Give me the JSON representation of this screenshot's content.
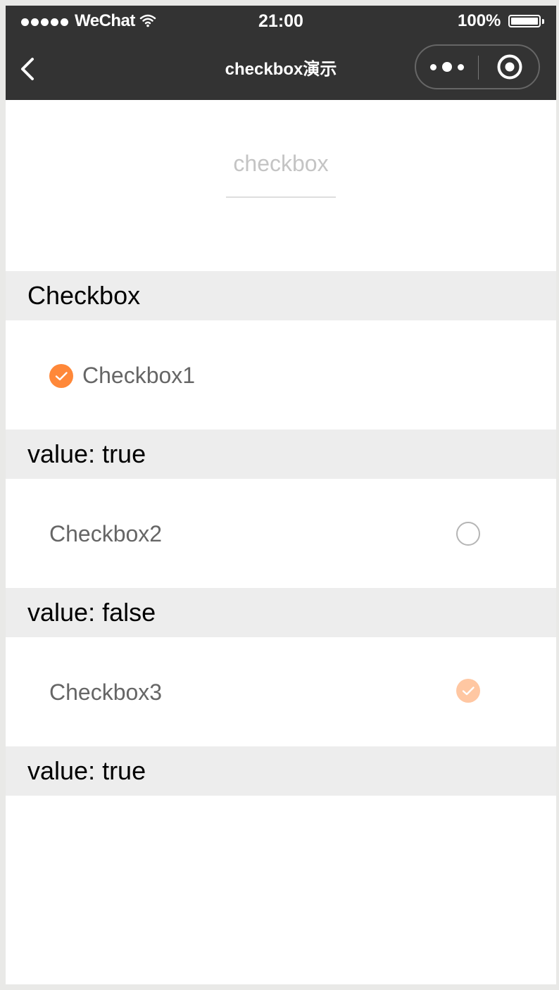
{
  "status_bar": {
    "carrier": "WeChat",
    "time": "21:00",
    "battery": "100%",
    "signal_bars": 5,
    "battery_level": 1.0
  },
  "nav": {
    "title": "checkbox演示",
    "back_icon": "back-chevron-icon",
    "more_icon": "more-dots-icon",
    "close_icon": "close-target-icon"
  },
  "page": {
    "heading": "checkbox"
  },
  "colors": {
    "nav_background": "#333333",
    "accent": "#ff8839",
    "accent_disabled": "#ffc7a2",
    "section_background": "#ededed"
  },
  "items": [
    {
      "label": "Checkbox1",
      "checked": true,
      "disabled": false,
      "value_text": "value: true"
    },
    {
      "label": "Checkbox2",
      "checked": false,
      "disabled": false,
      "value_text": "value: false"
    },
    {
      "label": "Checkbox3",
      "checked": true,
      "disabled": true,
      "value_text": "value: true"
    }
  ],
  "section_title": "Checkbox"
}
